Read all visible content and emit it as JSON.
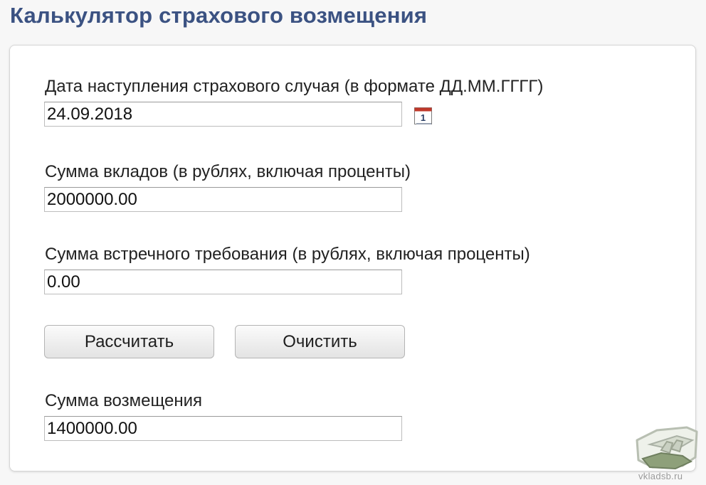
{
  "page_title": "Калькулятор страхового возмещения",
  "form": {
    "date_label": "Дата наступления страхового случая (в формате ДД.ММ.ГГГГ)",
    "date_value": "24.09.2018",
    "deposits_label": "Сумма вкладов (в рублях, включая проценты)",
    "deposits_value": "2000000.00",
    "counterclaim_label": "Сумма встречного требования (в рублях, включая проценты)",
    "counterclaim_value": "0.00",
    "calculate_label": "Рассчитать",
    "clear_label": "Очистить",
    "result_label": "Сумма возмещения",
    "result_value": "1400000.00",
    "calendar_icon": "calendar-icon",
    "calendar_day": "1"
  },
  "watermark": {
    "text": "vkladsb.ru",
    "icon": "hand-money-icon"
  },
  "colors": {
    "title": "#3b5282",
    "calendar_accent": "#c0392b",
    "watermark": "#9a9a9a"
  }
}
